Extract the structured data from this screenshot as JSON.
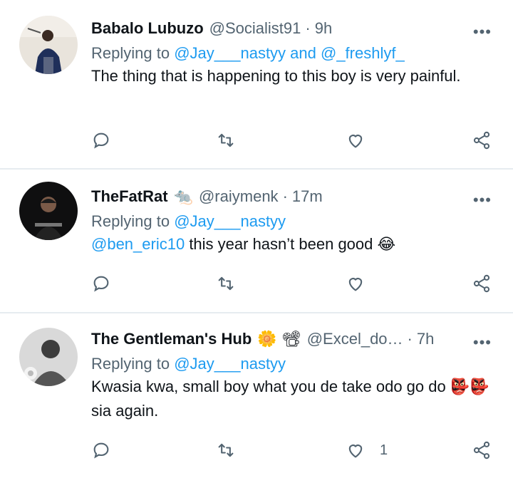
{
  "tweets": [
    {
      "name": "Babalo Lubuzo",
      "handle": "@Socialist91",
      "dot": "·",
      "time": "9h",
      "replying_label": "Replying to",
      "replying_users": "@Jay___nastyy and @_freshlyf_",
      "text": "The thing that is happening to this boy is very painful.",
      "like_count": ""
    },
    {
      "name": "TheFatRat",
      "name_emoji": "🐀",
      "handle": "@raiymenk",
      "dot": "·",
      "time": "17m",
      "replying_label": "Replying to",
      "replying_users": "@Jay___nastyy",
      "mention": "@ben_eric10",
      "text": " this year hasn’t been good 😂",
      "like_count": ""
    },
    {
      "name": "The Gentleman's Hub",
      "name_emoji": "🌼 📽",
      "handle": "@Excel_do…",
      "dot": "·",
      "time": "7h",
      "replying_label": "Replying to",
      "replying_users": "@Jay___nastyy",
      "text": "Kwasia kwa, small boy what you de take odo go do 👺👺sia again.",
      "like_count": "1"
    }
  ],
  "more_label": "•••",
  "colors": {
    "accent": "#1d9bf0",
    "muted": "#536471",
    "divider": "#e6ecf0"
  },
  "icons": [
    "reply-icon",
    "retweet-icon",
    "like-icon",
    "share-icon",
    "more-icon"
  ]
}
